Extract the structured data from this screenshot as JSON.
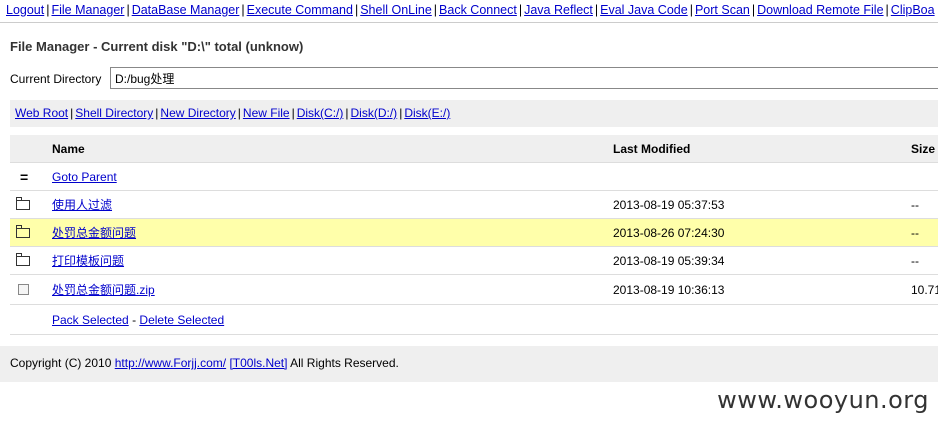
{
  "nav": {
    "items": [
      "Logout",
      "File Manager",
      "DataBase Manager",
      "Execute Command",
      "Shell OnLine",
      "Back Connect",
      "Java Reflect",
      "Eval Java Code",
      "Port Scan",
      "Download Remote File",
      "ClipBoa"
    ]
  },
  "page": {
    "title": "File Manager - Current disk \"D:\\\" total (unknow)"
  },
  "current_directory": {
    "label": "Current Directory",
    "value": "D:/bug处理"
  },
  "quick_links": [
    "Web Root",
    "Shell Directory",
    "New Directory",
    "New File",
    "Disk(C:/)",
    "Disk(D:/)",
    "Disk(E:/)"
  ],
  "table": {
    "headers": {
      "name": "Name",
      "modified": "Last Modified",
      "size": "Size"
    },
    "parent": {
      "icon": "=",
      "label": "Goto Parent"
    },
    "rows": [
      {
        "icon": "folder-icon",
        "name": "使用人过滤",
        "modified": "2013-08-19 05:37:53",
        "size": "--"
      },
      {
        "icon": "folder-icon",
        "name": "处罚总金额问题",
        "modified": "2013-08-26 07:24:30",
        "size": "--"
      },
      {
        "icon": "folder-icon",
        "name": "打印模板问题",
        "modified": "2013-08-19 05:39:34",
        "size": "--"
      },
      {
        "icon": "checkbox-icon",
        "name": "处罚总金额问题.zip",
        "modified": "2013-08-19 10:36:13",
        "size": "10.71"
      }
    ],
    "actions": {
      "pack": "Pack Selected",
      "sep": "-",
      "delete": "Delete Selected"
    }
  },
  "footer": {
    "prefix": "Copyright (C) 2010",
    "link1": "http://www.Forjj.com/",
    "link2": "[T00ls.Net]",
    "suffix": "All Rights Reserved."
  },
  "watermark": "www.wooyun.org",
  "colors": {
    "link": "#0000cc",
    "highlight_row": "#ffffaa",
    "bar_bg": "#efefef"
  }
}
